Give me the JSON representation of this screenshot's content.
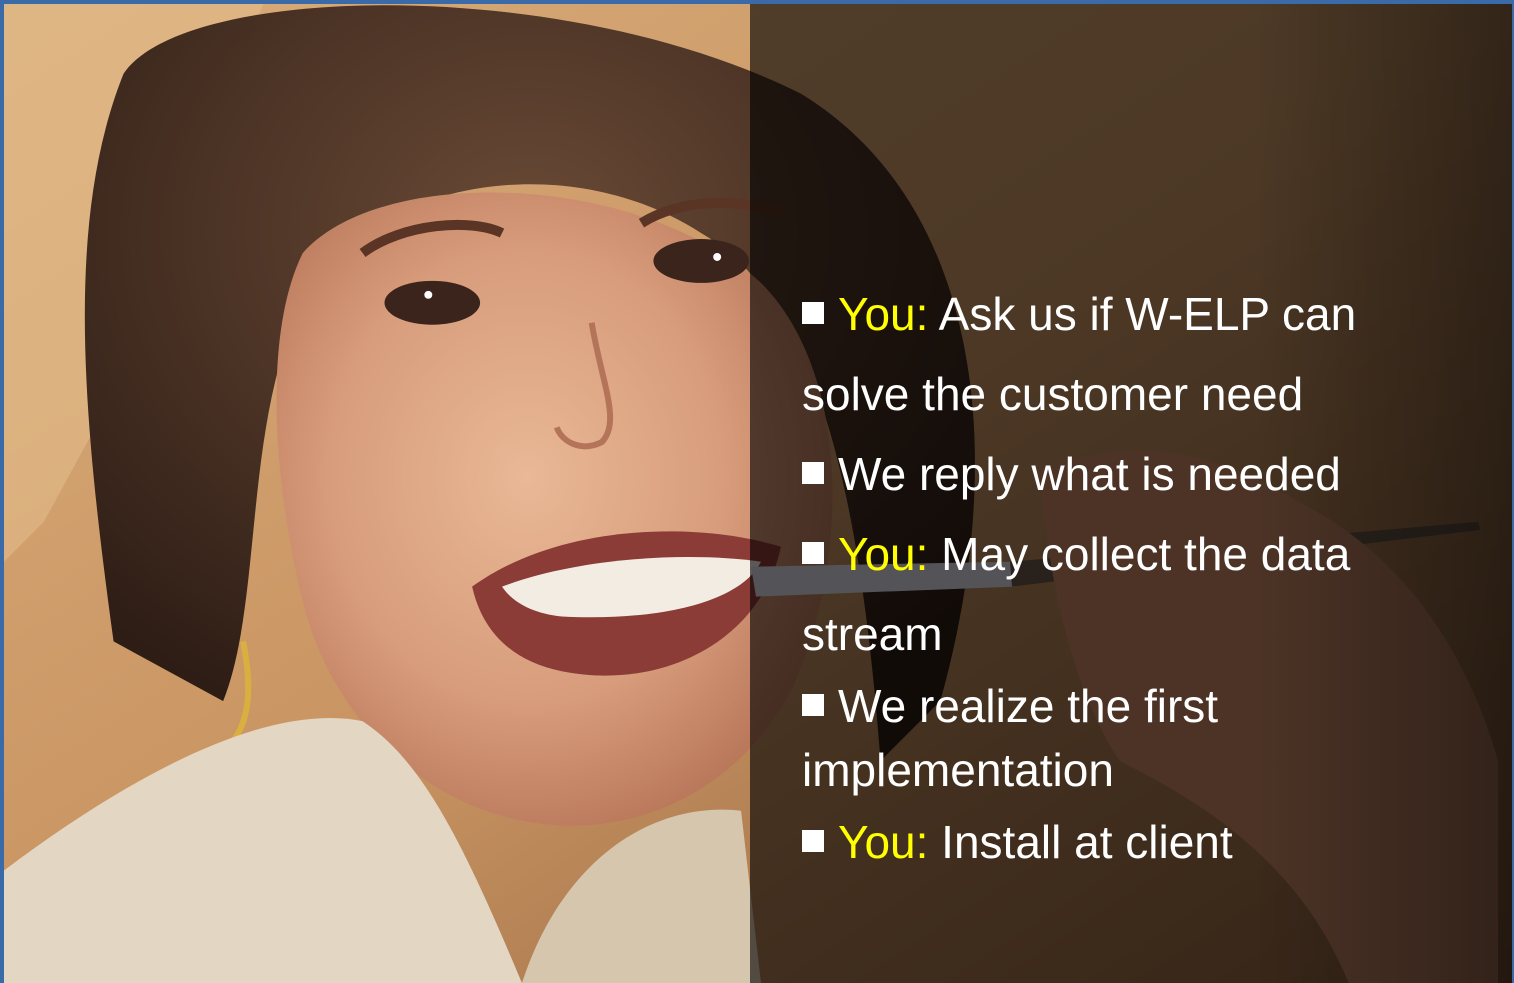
{
  "slide": {
    "photo_description_icon": "smiling-woman-with-pen-photo",
    "colors": {
      "frame": "#3a6aa8",
      "highlight": "#ffff00",
      "text": "#ffffff",
      "overlay": "rgba(0,0,0,0.62)"
    },
    "bullets": [
      {
        "who": "You:",
        "text": " Ask us if W-ELP can",
        "cont": "solve the customer need"
      },
      {
        "who": "",
        "text": "We reply what is needed",
        "cont": ""
      },
      {
        "who": "You:",
        "text": " May collect the data",
        "cont": "stream"
      },
      {
        "who": "",
        "text": "We realize the first",
        "cont": "implementation"
      },
      {
        "who": "You:",
        "text": " Install at client",
        "cont": ""
      }
    ]
  }
}
